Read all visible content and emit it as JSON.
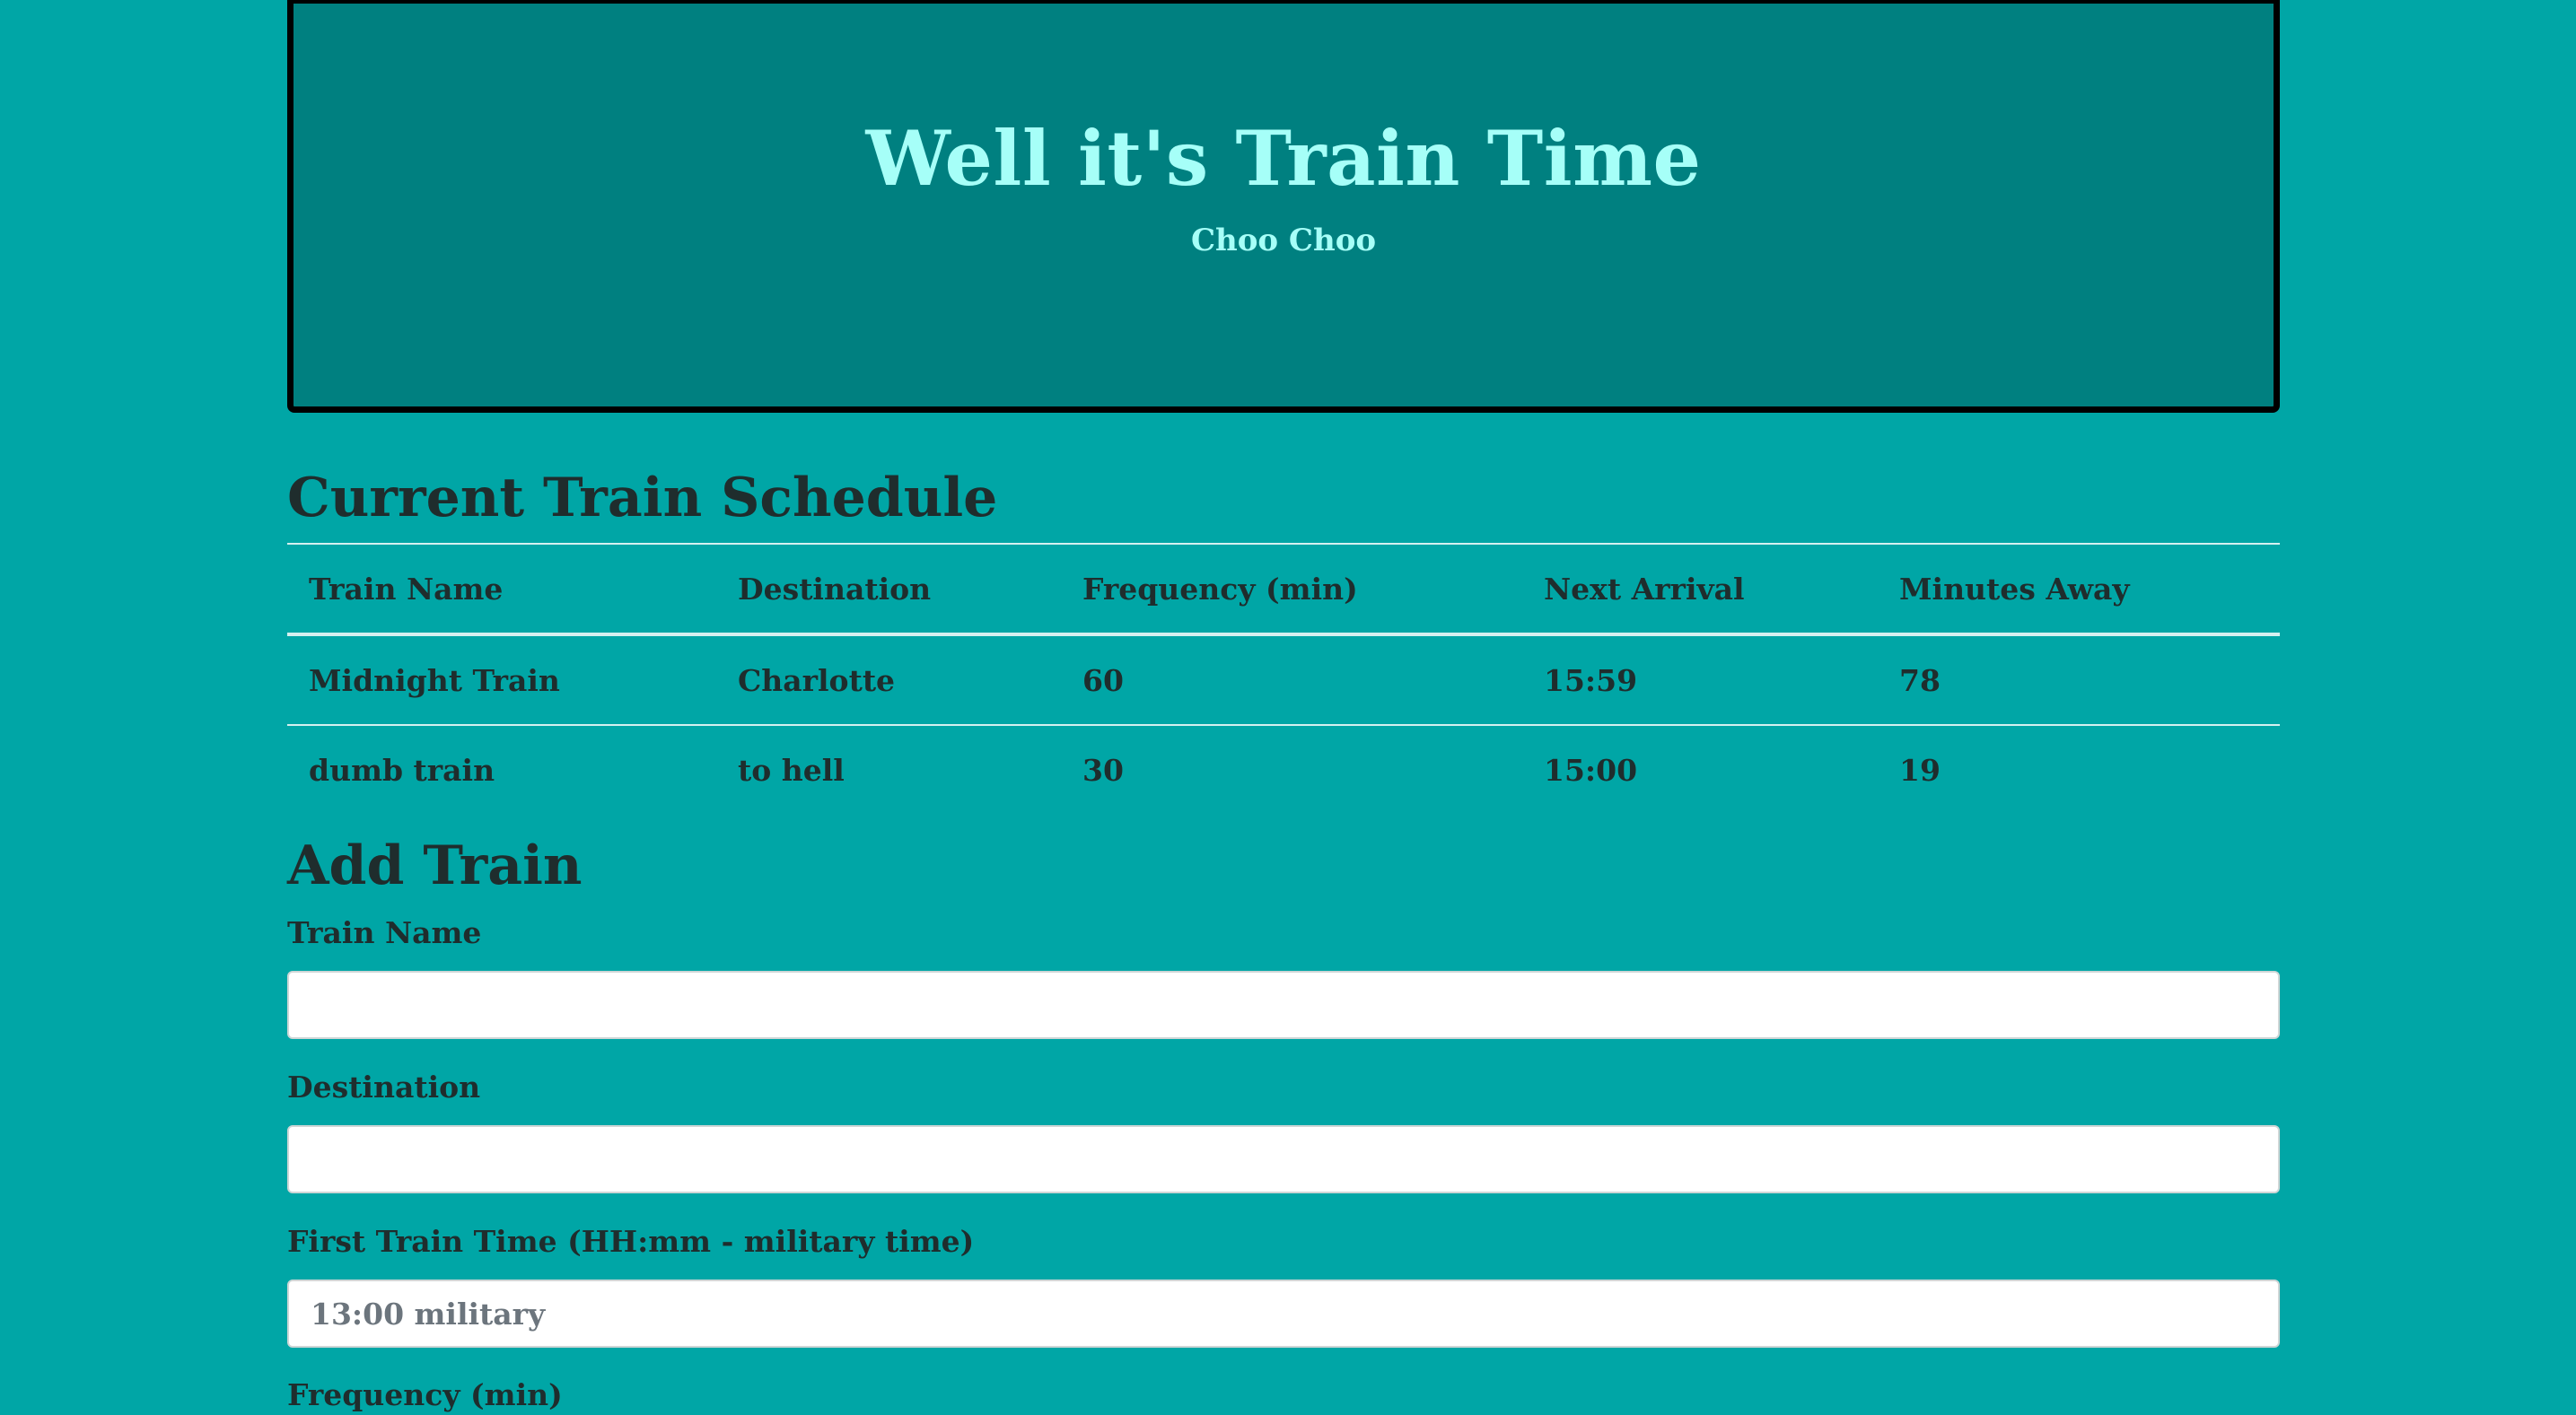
{
  "hero": {
    "title": "Well it's Train Time",
    "subtitle": "Choo Choo"
  },
  "schedule": {
    "title": "Current Train Schedule",
    "columns": [
      "Train Name",
      "Destination",
      "Frequency (min)",
      "Next Arrival",
      "Minutes Away"
    ],
    "rows": [
      [
        "Midnight Train",
        "Charlotte",
        "60",
        "15:59",
        "78"
      ],
      [
        "dumb train",
        "to hell",
        "30",
        "15:00",
        "19"
      ]
    ]
  },
  "form": {
    "title": "Add Train",
    "train_name_label": "Train Name",
    "train_name_value": "",
    "destination_label": "Destination",
    "destination_value": "",
    "first_time_label": "First Train Time (HH:mm - military time)",
    "first_time_placeholder": "13:00 military",
    "frequency_label": "Frequency (min)"
  },
  "colors": {
    "page_background": "#00a6a6",
    "hero_background": "#008080",
    "hero_text": "#a6fff8",
    "body_text": "#1f2d2d"
  }
}
